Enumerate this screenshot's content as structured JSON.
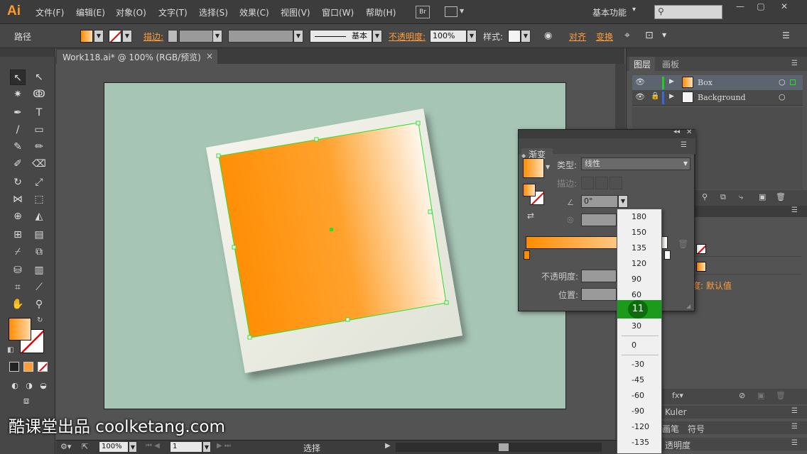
{
  "app": {
    "logo": "Ai"
  },
  "menu": [
    "文件(F)",
    "编辑(E)",
    "对象(O)",
    "文字(T)",
    "选择(S)",
    "效果(C)",
    "视图(V)",
    "窗口(W)",
    "帮助(H)"
  ],
  "bridge_label": "Br",
  "workspace": "基本功能",
  "control": {
    "object_type": "路径",
    "stroke_label": "描边:",
    "stroke_style": "基本",
    "opacity_label": "不透明度:",
    "opacity_value": "100%",
    "style_label": "样式:",
    "align_label": "对齐",
    "transform_label": "变换"
  },
  "document": {
    "tab_title": "Work118.ai* @ 100% (RGB/预览)"
  },
  "layers_panel": {
    "tabs": [
      "图层",
      "画板"
    ],
    "layers": [
      {
        "name": "Box"
      },
      {
        "name": "Background"
      }
    ]
  },
  "gradient_panel": {
    "title": "渐变",
    "type_label": "类型:",
    "type_value": "线性",
    "stroke_label": "描边:",
    "angle_value": "0°",
    "opacity_label": "不透明度:",
    "location_label": "位置:"
  },
  "angle_options": [
    "180",
    "150",
    "135",
    "120",
    "90",
    "60",
    "11",
    "30",
    "0",
    "-30",
    "-45",
    "-60",
    "-90",
    "-120",
    "-135"
  ],
  "angle_selected": "11",
  "appearance_panel": {
    "opacity_text": "度: 默认值"
  },
  "lower_panels": {
    "kuler": "Kuler",
    "brushes": "画笔",
    "symbols": "符号",
    "transparency": "透明度"
  },
  "status": {
    "zoom": "100%",
    "page": "1",
    "tool": "选择"
  },
  "watermark": "酷课堂出品 coolketang.com",
  "colors": {
    "accent_orange": "#ff9d3c",
    "gradient_start": "#ff8c00",
    "gradient_end": "#ffffff",
    "selection": "#28e028",
    "artboard_bg": "#a7c5b5"
  }
}
